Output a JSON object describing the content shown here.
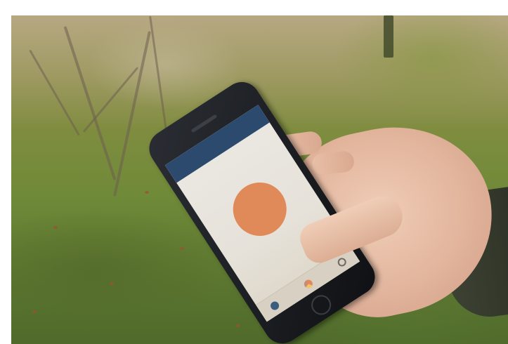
{
  "scene": {
    "description_tag": "photo-hand-holding-phone"
  },
  "phone_screen": {
    "status_left": "",
    "status_time": "",
    "status_right": "",
    "app_title": "",
    "record_button_line1": "",
    "record_button_line2": "",
    "info_line1": "",
    "info_line2": "",
    "info_line3": "",
    "info_line4": ""
  },
  "colors": {
    "header_blue": "#2c4a6e",
    "record_orange": "#e08a5a",
    "screen_bg": "#ebe8e2"
  },
  "icons": {
    "nav_home": "home-icon",
    "nav_pie": "pie-chart-icon",
    "nav_settings": "settings-icon"
  }
}
